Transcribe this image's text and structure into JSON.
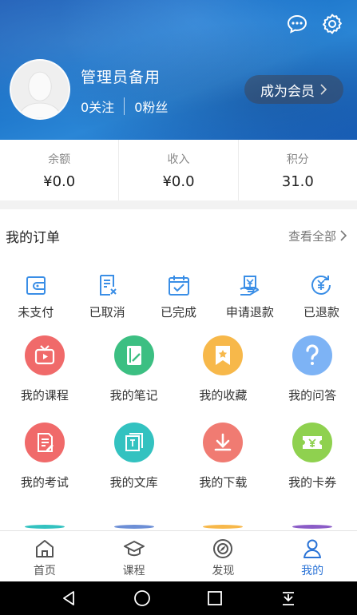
{
  "header": {
    "username": "管理员备用",
    "follow_count": "0关注",
    "fans_count": "0粉丝",
    "vip_label": "成为会员",
    "icons": [
      "message-icon",
      "gear-icon",
      "avatar"
    ]
  },
  "stats": [
    {
      "label": "余额",
      "value": "¥0.0"
    },
    {
      "label": "收入",
      "value": "¥0.0"
    },
    {
      "label": "积分",
      "value": "31.0"
    }
  ],
  "orders": {
    "title": "我的订单",
    "view_all": "查看全部",
    "items": [
      {
        "label": "未支付",
        "icon": "wallet-icon"
      },
      {
        "label": "已取消",
        "icon": "cancel-doc-icon"
      },
      {
        "label": "已完成",
        "icon": "check-box-icon"
      },
      {
        "label": "申请退款",
        "icon": "refund-request-icon"
      },
      {
        "label": "已退款",
        "icon": "refunded-icon"
      }
    ]
  },
  "features": [
    {
      "label": "我的课程",
      "icon": "tv-play-icon",
      "color": "#f06a6a"
    },
    {
      "label": "我的笔记",
      "icon": "note-icon",
      "color": "#3cbf82"
    },
    {
      "label": "我的收藏",
      "icon": "bookmark-star-icon",
      "color": "#f7b84a"
    },
    {
      "label": "我的问答",
      "icon": "question-icon",
      "color": "#7db3f5"
    },
    {
      "label": "我的考试",
      "icon": "exam-icon",
      "color": "#f06a6a"
    },
    {
      "label": "我的文库",
      "icon": "library-icon",
      "color": "#33c2c0"
    },
    {
      "label": "我的下载",
      "icon": "download-icon",
      "color": "#f07b72"
    },
    {
      "label": "我的卡券",
      "icon": "coupon-icon",
      "color": "#8fd14f"
    }
  ],
  "partial_colors": [
    "#33c2c0",
    "#6d8fd6",
    "#f7b84a",
    "#8b5cc7"
  ],
  "tabs": [
    {
      "label": "首页",
      "icon": "home-icon",
      "active": false
    },
    {
      "label": "课程",
      "icon": "graduation-cap-icon",
      "active": false
    },
    {
      "label": "发现",
      "icon": "compass-icon",
      "active": false
    },
    {
      "label": "我的",
      "icon": "user-icon",
      "active": true
    }
  ],
  "colors": {
    "accent": "#2a73d6",
    "order_icon": "#3a8ee6"
  }
}
